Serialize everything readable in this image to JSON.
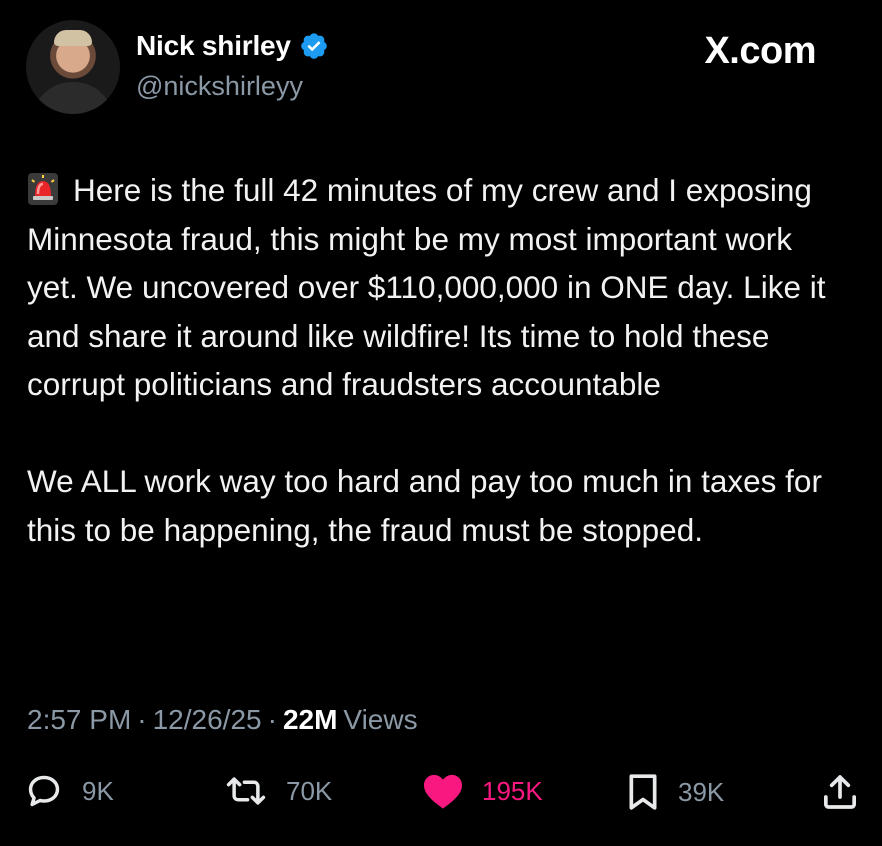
{
  "author": {
    "display_name": "Nick shirley",
    "handle": "@nickshirleyy",
    "verified": true,
    "avatar_icon": "avatar-photo"
  },
  "site": {
    "logo_text": "X.com"
  },
  "tweet": {
    "emoji_icon": "police-siren-icon",
    "paragraph_1": "Here is the full 42 minutes of my crew and I exposing Minnesota fraud, this might be my most important work yet. We uncovered over $110,000,000 in ONE day. Like it and share it around like wildfire! Its time to hold these corrupt politicians and fraudsters accountable",
    "paragraph_2": "We ALL work way too hard and pay too much in taxes for this to be happening, the fraud must be stopped."
  },
  "meta": {
    "time": "2:57 PM",
    "sep1": "·",
    "date": "12/26/25",
    "sep2": "·",
    "views_count": "22M",
    "views_label": "Views"
  },
  "actions": {
    "replies": {
      "icon": "reply-icon",
      "count": "9K"
    },
    "reposts": {
      "icon": "repost-icon",
      "count": "70K"
    },
    "likes": {
      "icon": "heart-icon",
      "count": "195K",
      "active": true
    },
    "bookmarks": {
      "icon": "bookmark-icon",
      "count": "39K"
    },
    "share": {
      "icon": "share-icon"
    }
  },
  "colors": {
    "background": "#000000",
    "text": "#e7e9ea",
    "muted": "#8b98a5",
    "like_active": "#f91880",
    "verified_blue": "#1d9bf0"
  }
}
